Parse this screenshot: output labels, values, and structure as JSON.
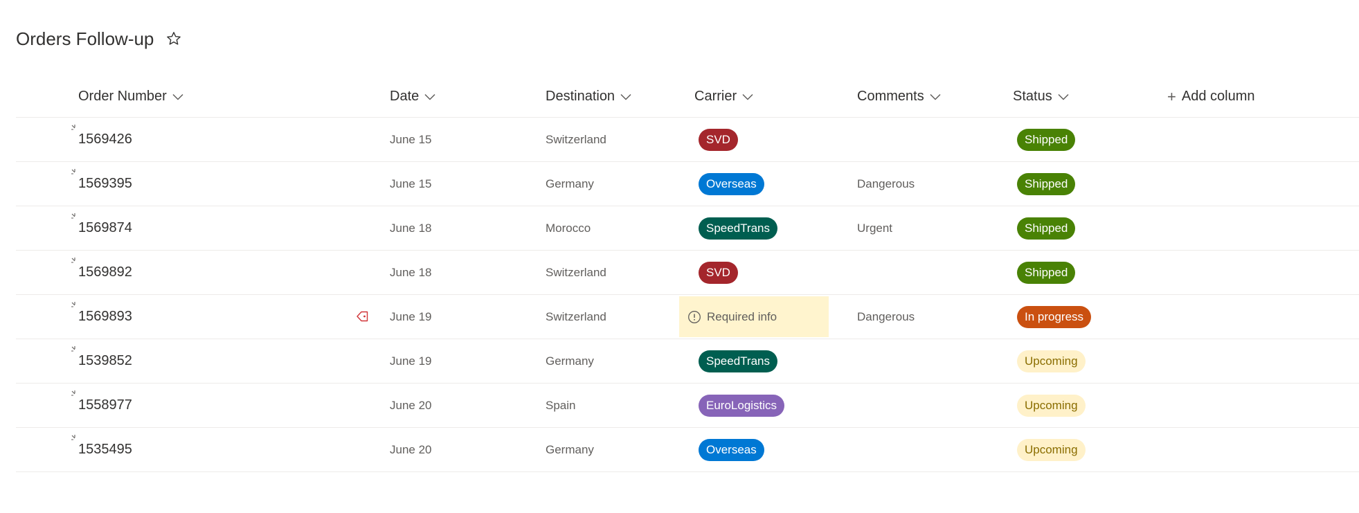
{
  "page": {
    "title": "Orders Follow-up"
  },
  "icons": {
    "favorite": "star-icon",
    "sort": "chevron-down-icon",
    "add": "plus-icon",
    "new_item": "new-item-spark-icon",
    "tag": "tag-warning-icon",
    "info": "info-circle-icon"
  },
  "columns": {
    "order_number": "Order Number",
    "date": "Date",
    "destination": "Destination",
    "carrier": "Carrier",
    "comments": "Comments",
    "status": "Status",
    "add_column": "Add column"
  },
  "colors": {
    "SVD": "#a4262c",
    "Overseas": "#0078d4",
    "SpeedTrans": "#005e50",
    "EuroLogistics": "#8764b8",
    "Shipped": "#498205",
    "In progress": "#ca5010",
    "Upcoming": "#fff1c9",
    "Required info": "#fff4ce"
  },
  "rows": [
    {
      "order": "1569426",
      "date": "June 15",
      "destination": "Switzerland",
      "carrier": "SVD",
      "comments": "",
      "status": "Shipped"
    },
    {
      "order": "1569395",
      "date": "June 15",
      "destination": "Germany",
      "carrier": "Overseas",
      "comments": "Dangerous",
      "status": "Shipped"
    },
    {
      "order": "1569874",
      "date": "June 18",
      "destination": "Morocco",
      "carrier": "SpeedTrans",
      "comments": "Urgent",
      "status": "Shipped"
    },
    {
      "order": "1569892",
      "date": "June 18",
      "destination": "Switzerland",
      "carrier": "SVD",
      "comments": "",
      "status": "Shipped"
    },
    {
      "order": "1569893",
      "date": "June 19",
      "destination": "Switzerland",
      "carrier": "Required info",
      "comments": "Dangerous",
      "status": "In progress"
    },
    {
      "order": "1539852",
      "date": "June 19",
      "destination": "Germany",
      "carrier": "SpeedTrans",
      "comments": "",
      "status": "Upcoming"
    },
    {
      "order": "1558977",
      "date": "June 20",
      "destination": "Spain",
      "carrier": "EuroLogistics",
      "comments": "",
      "status": "Upcoming"
    },
    {
      "order": "1535495",
      "date": "June 20",
      "destination": "Germany",
      "carrier": "Overseas",
      "comments": "",
      "status": "Upcoming"
    }
  ]
}
